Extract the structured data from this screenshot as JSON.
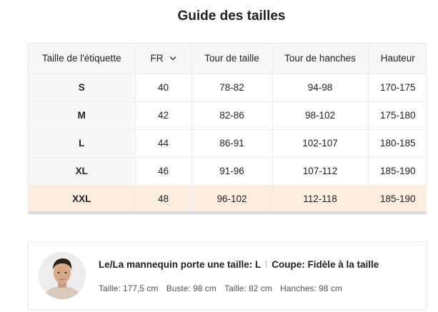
{
  "title": "Guide des tailles",
  "table": {
    "headers": [
      "Taille de l'étiquette",
      "FR",
      "Tour de taille",
      "Tour de hanches",
      "Hauteur"
    ],
    "rows": [
      [
        "S",
        "40",
        "78-82",
        "94-98",
        "170-175"
      ],
      [
        "M",
        "42",
        "82-86",
        "98-102",
        "175-180"
      ],
      [
        "L",
        "44",
        "86-91",
        "102-107",
        "180-185"
      ],
      [
        "XL",
        "46",
        "91-96",
        "107-112",
        "185-190"
      ],
      [
        "XXL",
        "48",
        "96-102",
        "112-118",
        "185-190"
      ]
    ],
    "highlighted_size": "XXL",
    "highlight_color": "#fdeee0"
  },
  "model": {
    "wears_label": "Le/La mannequin porte une taille: L",
    "fit_label": "Coupe: Fidèle à la taille",
    "height": "Taille: 177,5 cm",
    "bust": "Buste: 98 cm",
    "waist": "Taille: 82 cm",
    "hips": "Hanches: 98 cm"
  },
  "icons": {
    "fr_dropdown": "chevron-down-icon",
    "model_photo": "avatar"
  }
}
